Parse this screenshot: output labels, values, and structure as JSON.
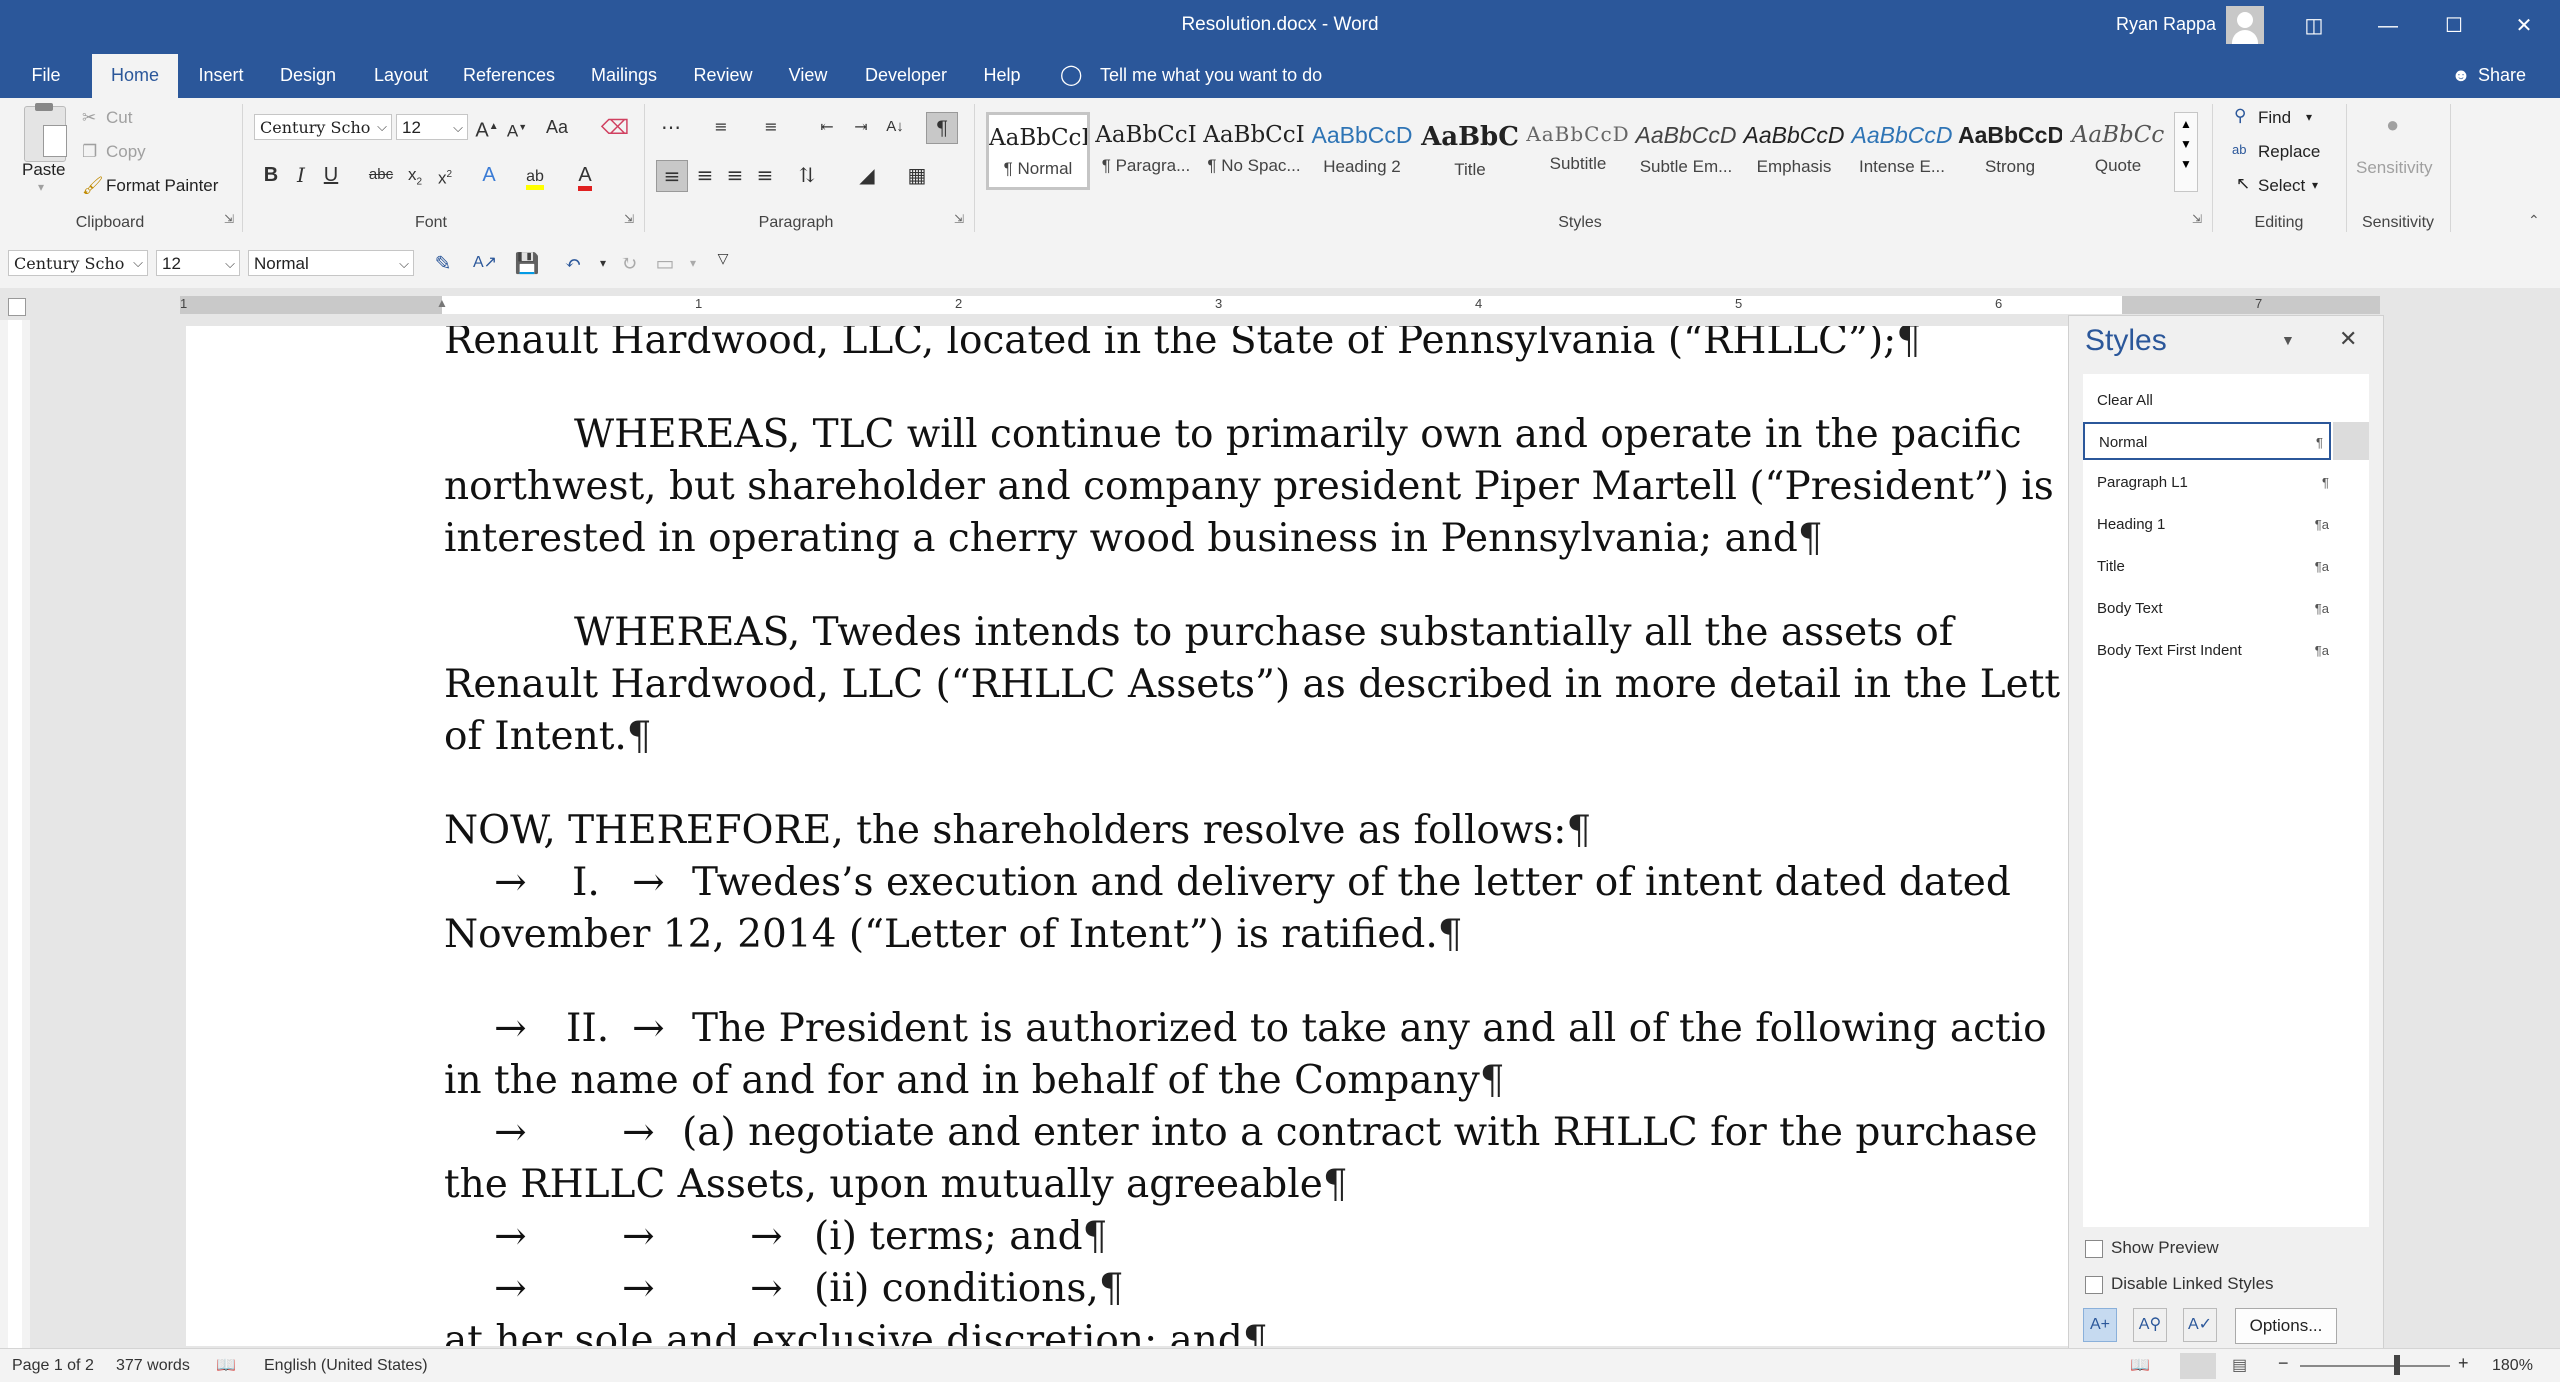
{
  "window": {
    "title": "Resolution.docx  -  Word",
    "user": "Ryan Rappa",
    "controls": [
      "ribbon-display-icon",
      "minimize-icon",
      "maximize-icon",
      "close-icon"
    ]
  },
  "tabs": {
    "items": [
      "File",
      "Home",
      "Insert",
      "Design",
      "Layout",
      "References",
      "Mailings",
      "Review",
      "View",
      "Developer",
      "Help"
    ],
    "active": "Home",
    "tell_me": "Tell me what you want to do",
    "share": "Share"
  },
  "ribbon": {
    "clipboard": {
      "paste": "Paste",
      "cut": "Cut",
      "copy": "Copy",
      "format_painter": "Format Painter",
      "label": "Clipboard"
    },
    "font": {
      "family": "Century Scho",
      "size": "12",
      "label": "Font"
    },
    "paragraph": {
      "label": "Paragraph"
    },
    "styles": {
      "items": [
        {
          "preview": "AaBbCcI",
          "name": "¶ Normal"
        },
        {
          "preview": "AaBbCcI",
          "name": "¶ Paragra..."
        },
        {
          "preview": "AaBbCcI",
          "name": "¶ No Spac..."
        },
        {
          "preview": "AaBbCcD",
          "name": "Heading 2"
        },
        {
          "preview": "AaBbC",
          "name": "Title"
        },
        {
          "preview": "AaBbCcD",
          "name": "Subtitle"
        },
        {
          "preview": "AaBbCcD",
          "name": "Subtle Em..."
        },
        {
          "preview": "AaBbCcD",
          "name": "Emphasis"
        },
        {
          "preview": "AaBbCcD",
          "name": "Intense E..."
        },
        {
          "preview": "AaBbCcD",
          "name": "Strong"
        },
        {
          "preview": "AaBbCc",
          "name": "Quote"
        }
      ],
      "label": "Styles"
    },
    "editing": {
      "find": "Find",
      "replace": "Replace",
      "select": "Select",
      "label": "Editing"
    },
    "sensitivity": {
      "button": "Sensitivity",
      "label": "Sensitivity"
    }
  },
  "qat": {
    "font": "Century Scho",
    "size": "12",
    "style": "Normal"
  },
  "ruler": {
    "numbers": [
      "1",
      "1",
      "2",
      "3",
      "4",
      "5",
      "6",
      "7"
    ]
  },
  "document": {
    "lines": [
      "Renault Hardwood, LLC, located in the State of Pennsylvania (“RHLLC”);",
      "WHEREAS, TLC will continue to primarily own and operate in the pacific",
      "northwest, but shareholder and company president Piper Martell (“President”) is",
      "interested in operating a cherry wood business in Pennsylvania; and",
      "WHEREAS, Twedes intends to purchase substantially all the assets of",
      "Renault Hardwood, LLC (“RHLLC Assets”) as described in more detail in the Lett",
      "of Intent.",
      "NOW, THEREFORE, the shareholders resolve as follows:",
      "I.",
      "Twedes’s execution and delivery of the letter of intent dated dated",
      "November 12, 2014 (“Letter of Intent”) is ratified.",
      "II.",
      "The President is authorized to take any and all of the following actio",
      "in the name of and for and in behalf of the Company",
      "(a) negotiate and enter into a contract with RHLLC for the purchase",
      "the RHLLC Assets, upon mutually agreeable",
      "(i) terms; and",
      "(ii) conditions,",
      "at her sole and exclusive discretion; and"
    ],
    "pilcrow": "¶",
    "arrow": "→"
  },
  "styles_pane": {
    "title": "Styles",
    "items": [
      "Clear All",
      "Normal",
      "Paragraph L1",
      "Heading 1",
      "Title",
      "Body Text",
      "Body Text First Indent"
    ],
    "selected": "Normal",
    "show_preview": "Show Preview",
    "disable_linked": "Disable Linked Styles",
    "options": "Options..."
  },
  "status": {
    "page": "Page 1 of 2",
    "words": "377 words",
    "language": "English (United States)",
    "zoom": "180%"
  },
  "colors": {
    "accent": "#2b579a",
    "ribbon": "#f3f3f3"
  }
}
